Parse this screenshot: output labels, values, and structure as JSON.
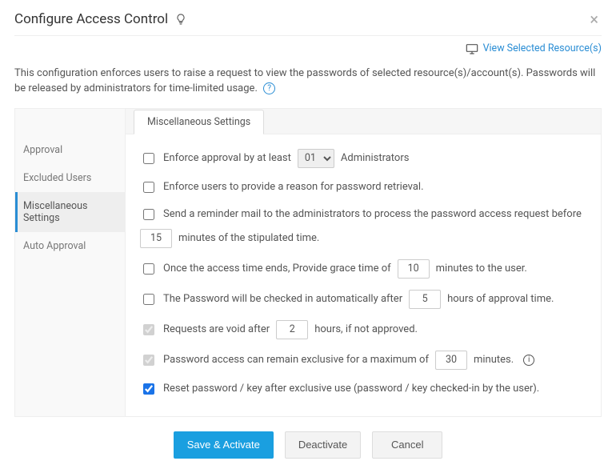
{
  "header": {
    "title": "Configure Access Control",
    "close_label": "×"
  },
  "view_link": {
    "label": "View Selected Resource(s)"
  },
  "description": "This configuration enforces users to raise a request to view the passwords of selected resource(s)/account(s). Passwords will be released by administrators for time-limited usage.",
  "sidebar": {
    "items": [
      {
        "label": "Approval",
        "active": false
      },
      {
        "label": "Excluded Users",
        "active": false
      },
      {
        "label": "Miscellaneous Settings",
        "active": true
      },
      {
        "label": "Auto Approval",
        "active": false
      }
    ]
  },
  "tabs": {
    "active": "Miscellaneous Settings"
  },
  "settings": {
    "enforce_approval": {
      "checked": false,
      "pre": "Enforce approval by at least",
      "value": "01",
      "post": "Administrators"
    },
    "enforce_reason": {
      "checked": false,
      "label": "Enforce users to provide a reason for password retrieval."
    },
    "reminder_mail": {
      "checked": false,
      "pre": "Send a reminder mail to the administrators to process the password access request before",
      "value": "15",
      "post": "minutes of the stipulated time."
    },
    "grace_time": {
      "checked": false,
      "pre": "Once the access time ends, Provide grace time of",
      "value": "10",
      "post": "minutes to the user."
    },
    "auto_checkin": {
      "checked": false,
      "pre": "The Password will be checked in automatically after",
      "value": "5",
      "post": "hours of approval time."
    },
    "void_after": {
      "checked": true,
      "disabled": true,
      "pre": "Requests are void after",
      "value": "2",
      "post": "hours, if not approved."
    },
    "exclusive_max": {
      "checked": true,
      "disabled": true,
      "pre": "Password access can remain exclusive for a maximum of",
      "value": "30",
      "post": "minutes."
    },
    "reset_after_exclusive": {
      "checked": true,
      "label": "Reset password / key after exclusive use (password / key checked-in by the user)."
    }
  },
  "actions": {
    "save": "Save & Activate",
    "deactivate": "Deactivate",
    "cancel": "Cancel"
  }
}
